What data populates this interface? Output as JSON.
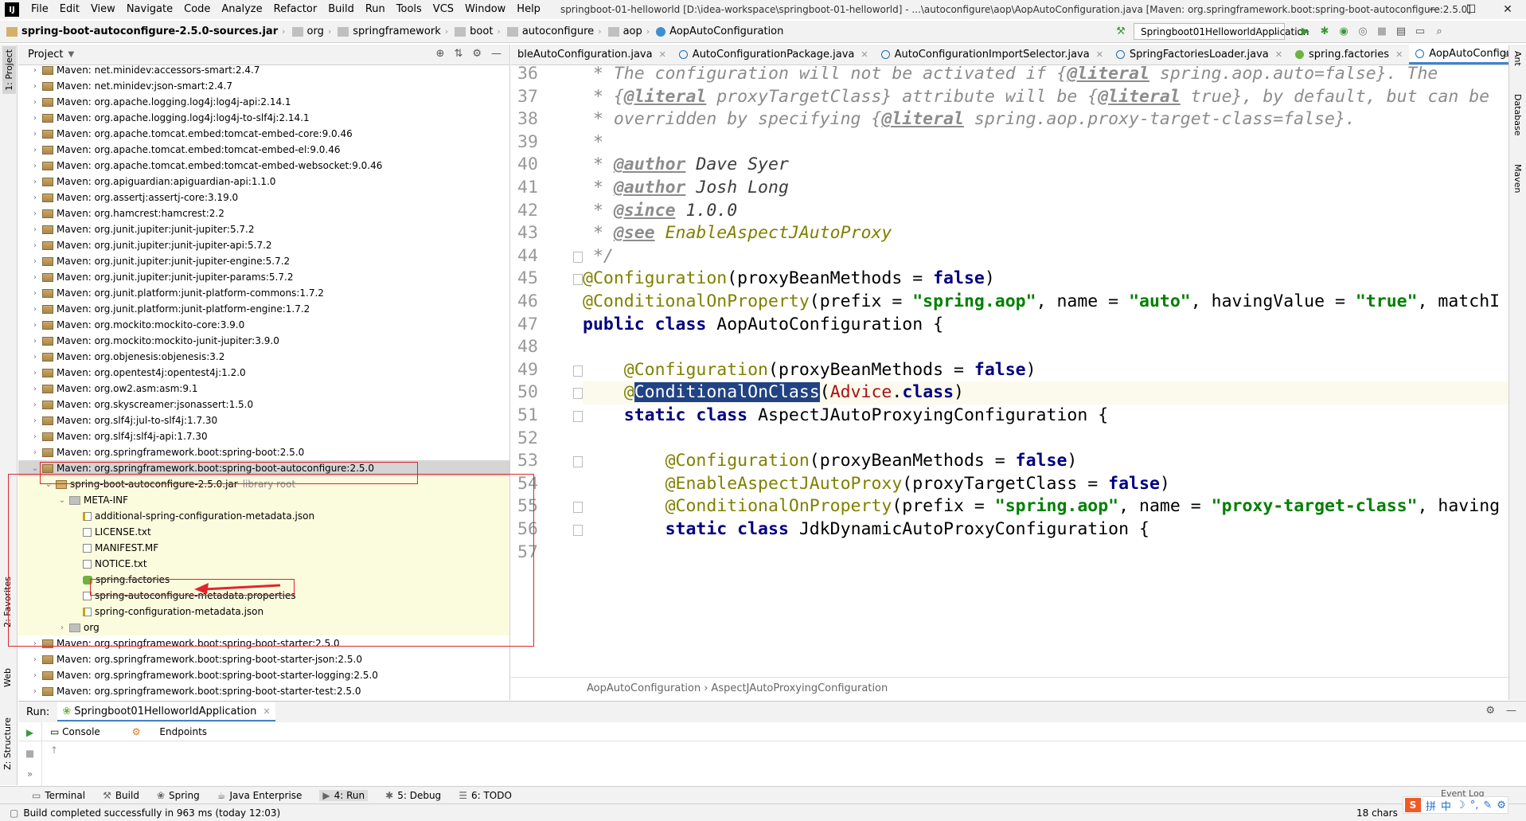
{
  "menubar": {
    "items": [
      "File",
      "Edit",
      "View",
      "Navigate",
      "Code",
      "Analyze",
      "Refactor",
      "Build",
      "Run",
      "Tools",
      "VCS",
      "Window",
      "Help"
    ],
    "window_title": "springboot-01-helloworld [D:\\idea-workspace\\springboot-01-helloworld] - ...\\autoconfigure\\aop\\AopAutoConfiguration.java [Maven: org.springframework.boot:spring-boot-autoconfigure:2.5.0]"
  },
  "navbar": {
    "crumbs": [
      "spring-boot-autoconfigure-2.5.0-sources.jar",
      "org",
      "springframework",
      "boot",
      "autoconfigure",
      "aop",
      "AopAutoConfiguration"
    ],
    "run_config": "Springboot01HelloworldApplication"
  },
  "left_stripe": {
    "project": "1: Project",
    "favorites": "2: Favorites",
    "web": "Web",
    "structure": "Z: Structure"
  },
  "right_stripe": {
    "ant": "Ant",
    "database": "Database",
    "maven": "Maven"
  },
  "project_panel": {
    "title": "Project",
    "tree": [
      {
        "label": "Maven: net.minidev:accessors-smart:2.4.7",
        "indent": 0,
        "type": "lib",
        "arrow": "›"
      },
      {
        "label": "Maven: net.minidev:json-smart:2.4.7",
        "indent": 0,
        "type": "lib",
        "arrow": "›"
      },
      {
        "label": "Maven: org.apache.logging.log4j:log4j-api:2.14.1",
        "indent": 0,
        "type": "lib",
        "arrow": "›"
      },
      {
        "label": "Maven: org.apache.logging.log4j:log4j-to-slf4j:2.14.1",
        "indent": 0,
        "type": "lib",
        "arrow": "›"
      },
      {
        "label": "Maven: org.apache.tomcat.embed:tomcat-embed-core:9.0.46",
        "indent": 0,
        "type": "lib",
        "arrow": "›"
      },
      {
        "label": "Maven: org.apache.tomcat.embed:tomcat-embed-el:9.0.46",
        "indent": 0,
        "type": "lib",
        "arrow": "›"
      },
      {
        "label": "Maven: org.apache.tomcat.embed:tomcat-embed-websocket:9.0.46",
        "indent": 0,
        "type": "lib",
        "arrow": "›"
      },
      {
        "label": "Maven: org.apiguardian:apiguardian-api:1.1.0",
        "indent": 0,
        "type": "lib",
        "arrow": "›"
      },
      {
        "label": "Maven: org.assertj:assertj-core:3.19.0",
        "indent": 0,
        "type": "lib",
        "arrow": "›"
      },
      {
        "label": "Maven: org.hamcrest:hamcrest:2.2",
        "indent": 0,
        "type": "lib",
        "arrow": "›"
      },
      {
        "label": "Maven: org.junit.jupiter:junit-jupiter:5.7.2",
        "indent": 0,
        "type": "lib",
        "arrow": "›"
      },
      {
        "label": "Maven: org.junit.jupiter:junit-jupiter-api:5.7.2",
        "indent": 0,
        "type": "lib",
        "arrow": "›"
      },
      {
        "label": "Maven: org.junit.jupiter:junit-jupiter-engine:5.7.2",
        "indent": 0,
        "type": "lib",
        "arrow": "›"
      },
      {
        "label": "Maven: org.junit.jupiter:junit-jupiter-params:5.7.2",
        "indent": 0,
        "type": "lib",
        "arrow": "›"
      },
      {
        "label": "Maven: org.junit.platform:junit-platform-commons:1.7.2",
        "indent": 0,
        "type": "lib",
        "arrow": "›"
      },
      {
        "label": "Maven: org.junit.platform:junit-platform-engine:1.7.2",
        "indent": 0,
        "type": "lib",
        "arrow": "›"
      },
      {
        "label": "Maven: org.mockito:mockito-core:3.9.0",
        "indent": 0,
        "type": "lib",
        "arrow": "›"
      },
      {
        "label": "Maven: org.mockito:mockito-junit-jupiter:3.9.0",
        "indent": 0,
        "type": "lib",
        "arrow": "›"
      },
      {
        "label": "Maven: org.objenesis:objenesis:3.2",
        "indent": 0,
        "type": "lib",
        "arrow": "›"
      },
      {
        "label": "Maven: org.opentest4j:opentest4j:1.2.0",
        "indent": 0,
        "type": "lib",
        "arrow": "›"
      },
      {
        "label": "Maven: org.ow2.asm:asm:9.1",
        "indent": 0,
        "type": "lib",
        "arrow": "›"
      },
      {
        "label": "Maven: org.skyscreamer:jsonassert:1.5.0",
        "indent": 0,
        "type": "lib",
        "arrow": "›"
      },
      {
        "label": "Maven: org.slf4j:jul-to-slf4j:1.7.30",
        "indent": 0,
        "type": "lib",
        "arrow": "›"
      },
      {
        "label": "Maven: org.slf4j:slf4j-api:1.7.30",
        "indent": 0,
        "type": "lib",
        "arrow": "›"
      },
      {
        "label": "Maven: org.springframework.boot:spring-boot:2.5.0",
        "indent": 0,
        "type": "lib",
        "arrow": "›"
      },
      {
        "label": "Maven: org.springframework.boot:spring-boot-autoconfigure:2.5.0",
        "indent": 0,
        "type": "lib",
        "arrow": "⌄",
        "selected": true
      },
      {
        "label": "spring-boot-autoconfigure-2.5.0.jar",
        "indent": 1,
        "type": "jar",
        "arrow": "⌄",
        "suffix": "library root"
      },
      {
        "label": "META-INF",
        "indent": 2,
        "type": "folder",
        "arrow": "⌄"
      },
      {
        "label": "additional-spring-configuration-metadata.json",
        "indent": 3,
        "type": "json",
        "arrow": ""
      },
      {
        "label": "LICENSE.txt",
        "indent": 3,
        "type": "file",
        "arrow": ""
      },
      {
        "label": "MANIFEST.MF",
        "indent": 3,
        "type": "file",
        "arrow": ""
      },
      {
        "label": "NOTICE.txt",
        "indent": 3,
        "type": "file",
        "arrow": ""
      },
      {
        "label": "spring.factories",
        "indent": 3,
        "type": "spring",
        "arrow": ""
      },
      {
        "label": "spring-autoconfigure-metadata.properties",
        "indent": 3,
        "type": "file",
        "arrow": ""
      },
      {
        "label": "spring-configuration-metadata.json",
        "indent": 3,
        "type": "json",
        "arrow": ""
      },
      {
        "label": "org",
        "indent": 2,
        "type": "folder",
        "arrow": "›"
      },
      {
        "label": "Maven: org.springframework.boot:spring-boot-starter:2.5.0",
        "indent": 0,
        "type": "lib",
        "arrow": "›"
      },
      {
        "label": "Maven: org.springframework.boot:spring-boot-starter-json:2.5.0",
        "indent": 0,
        "type": "lib",
        "arrow": "›"
      },
      {
        "label": "Maven: org.springframework.boot:spring-boot-starter-logging:2.5.0",
        "indent": 0,
        "type": "lib",
        "arrow": "›"
      },
      {
        "label": "Maven: org.springframework.boot:spring-boot-starter-test:2.5.0",
        "indent": 0,
        "type": "lib",
        "arrow": "›"
      }
    ]
  },
  "editor": {
    "tabs": [
      {
        "label": "bleAutoConfiguration.java",
        "active": false
      },
      {
        "label": "AutoConfigurationPackage.java",
        "active": false
      },
      {
        "label": "AutoConfigurationImportSelector.java",
        "active": false
      },
      {
        "label": "SpringFactoriesLoader.java",
        "active": false
      },
      {
        "label": "spring.factories",
        "active": false
      },
      {
        "label": "AopAutoConfiguration.java",
        "active": true
      }
    ],
    "tabs_menu": "≡3",
    "lines": [
      {
        "n": "36",
        "tokens": [
          [
            " * The configuration will not be activated if {",
            "comment"
          ],
          [
            "@literal",
            "tag"
          ],
          [
            " spring.aop.auto=false}. The",
            "comment"
          ]
        ]
      },
      {
        "n": "37",
        "tokens": [
          [
            " * {",
            "comment"
          ],
          [
            "@literal",
            "tag"
          ],
          [
            " proxyTargetClass} attribute will be {",
            "comment"
          ],
          [
            "@literal",
            "tag"
          ],
          [
            " true}, by default, but can be",
            "comment"
          ]
        ]
      },
      {
        "n": "38",
        "tokens": [
          [
            " * overridden by specifying {",
            "comment"
          ],
          [
            "@literal",
            "tag"
          ],
          [
            " spring.aop.proxy-target-class=false}.",
            "comment"
          ]
        ]
      },
      {
        "n": "39",
        "tokens": [
          [
            " *",
            "comment"
          ]
        ]
      },
      {
        "n": "40",
        "tokens": [
          [
            " * ",
            "comment"
          ],
          [
            "@author",
            "tag"
          ],
          [
            " Dave Syer",
            "tagval"
          ]
        ]
      },
      {
        "n": "41",
        "tokens": [
          [
            " * ",
            "comment"
          ],
          [
            "@author",
            "tag"
          ],
          [
            " Josh Long",
            "tagval"
          ]
        ]
      },
      {
        "n": "42",
        "tokens": [
          [
            " * ",
            "comment"
          ],
          [
            "@since",
            "tag"
          ],
          [
            " 1.0.0",
            "tagval"
          ]
        ]
      },
      {
        "n": "43",
        "tokens": [
          [
            " * ",
            "comment"
          ],
          [
            "@see",
            "tag"
          ],
          [
            " EnableAspectJAutoProxy",
            "see"
          ]
        ]
      },
      {
        "n": "44",
        "tokens": [
          [
            " */",
            "comment"
          ]
        ]
      },
      {
        "n": "45",
        "tokens": [
          [
            "@Configuration",
            "ann"
          ],
          [
            "(proxyBeanMethods = ",
            "plain"
          ],
          [
            "false",
            "kw"
          ],
          [
            ")",
            "plain"
          ]
        ]
      },
      {
        "n": "46",
        "tokens": [
          [
            "@ConditionalOnProperty",
            "ann"
          ],
          [
            "(prefix = ",
            "plain"
          ],
          [
            "\"spring.aop\"",
            "str"
          ],
          [
            ", name = ",
            "plain"
          ],
          [
            "\"auto\"",
            "str"
          ],
          [
            ", havingValue = ",
            "plain"
          ],
          [
            "\"true\"",
            "str"
          ],
          [
            ", matchI",
            "plain"
          ]
        ]
      },
      {
        "n": "47",
        "tokens": [
          [
            "public class ",
            "kw"
          ],
          [
            "AopAutoConfiguration {",
            "plain"
          ]
        ]
      },
      {
        "n": "48",
        "tokens": []
      },
      {
        "n": "49",
        "tokens": [
          [
            "    ",
            "plain"
          ],
          [
            "@Configuration",
            "ann"
          ],
          [
            "(proxyBeanMethods = ",
            "plain"
          ],
          [
            "false",
            "kw"
          ],
          [
            ")",
            "plain"
          ]
        ]
      },
      {
        "n": "50",
        "tokens": [
          [
            "    ",
            "plain"
          ],
          [
            "@",
            "ann"
          ],
          [
            "ConditionalOnClass",
            "sel"
          ],
          [
            "(",
            "plain"
          ],
          [
            "Advice",
            "red"
          ],
          [
            ".",
            "plain"
          ],
          [
            "class",
            "kw"
          ],
          [
            ")",
            "plain"
          ]
        ],
        "current": true
      },
      {
        "n": "51",
        "tokens": [
          [
            "    ",
            "plain"
          ],
          [
            "static class ",
            "kw"
          ],
          [
            "AspectJAutoProxyingConfiguration {",
            "plain"
          ]
        ]
      },
      {
        "n": "52",
        "tokens": []
      },
      {
        "n": "53",
        "tokens": [
          [
            "        ",
            "plain"
          ],
          [
            "@Configuration",
            "ann"
          ],
          [
            "(proxyBeanMethods = ",
            "plain"
          ],
          [
            "false",
            "kw"
          ],
          [
            ")",
            "plain"
          ]
        ]
      },
      {
        "n": "54",
        "tokens": [
          [
            "        ",
            "plain"
          ],
          [
            "@EnableAspectJAutoProxy",
            "ann"
          ],
          [
            "(proxyTargetClass = ",
            "plain"
          ],
          [
            "false",
            "kw"
          ],
          [
            ")",
            "plain"
          ]
        ]
      },
      {
        "n": "55",
        "tokens": [
          [
            "        ",
            "plain"
          ],
          [
            "@ConditionalOnProperty",
            "ann"
          ],
          [
            "(prefix = ",
            "plain"
          ],
          [
            "\"spring.aop\"",
            "str"
          ],
          [
            ", name = ",
            "plain"
          ],
          [
            "\"proxy-target-class\"",
            "str"
          ],
          [
            ", having",
            "plain"
          ]
        ]
      },
      {
        "n": "56",
        "tokens": [
          [
            "        ",
            "plain"
          ],
          [
            "static class ",
            "kw"
          ],
          [
            "JdkDynamicAutoProxyConfiguration {",
            "plain"
          ]
        ]
      },
      {
        "n": "57",
        "tokens": []
      }
    ],
    "breadcrumb": [
      "AopAutoConfiguration",
      "AspectJAutoProxyingConfiguration"
    ]
  },
  "run_panel": {
    "label": "Run:",
    "tab": "Springboot01HelloworldApplication",
    "subtabs": [
      "Console",
      "Endpoints"
    ]
  },
  "bottom_tools": [
    {
      "label": "Terminal",
      "active": false
    },
    {
      "label": "Build",
      "active": false
    },
    {
      "label": "Spring",
      "active": false
    },
    {
      "label": "Java Enterprise",
      "active": false
    },
    {
      "label": "4: Run",
      "active": true
    },
    {
      "label": "5: Debug",
      "active": false
    },
    {
      "label": "6: TODO",
      "active": false
    }
  ],
  "status": {
    "message": "Build completed successfully in 963 ms (today 12:03)",
    "chars": "18 chars",
    "event_log": "Event Log"
  },
  "ime": {
    "logo": "S",
    "items": [
      "拼",
      "中",
      "☽",
      "°,",
      "✎",
      "⚙"
    ]
  },
  "colors": {
    "accent": "#4083c9",
    "annotation_red": "#e0262d",
    "selection": "#214283"
  }
}
